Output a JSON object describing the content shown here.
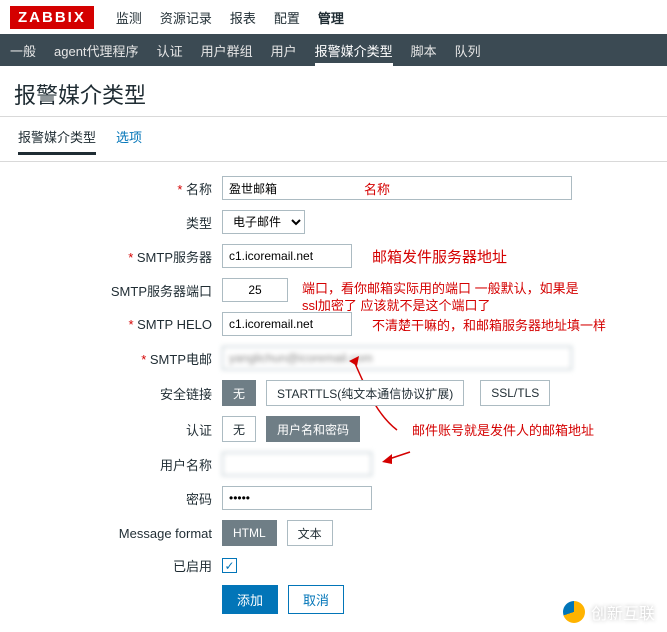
{
  "logo": "ZABBIX",
  "topmenu": [
    "监测",
    "资源记录",
    "报表",
    "配置",
    "管理"
  ],
  "topmenu_active": 4,
  "submenu": [
    "一般",
    "agent代理程序",
    "认证",
    "用户群组",
    "用户",
    "报警媒介类型",
    "脚本",
    "队列"
  ],
  "submenu_active": 5,
  "page_title": "报警媒介类型",
  "tabs": [
    "报警媒介类型",
    "选项"
  ],
  "tabs_active": 0,
  "labels": {
    "name": "名称",
    "type": "类型",
    "smtp_server": "SMTP服务器",
    "smtp_port": "SMTP服务器端口",
    "smtp_helo": "SMTP HELO",
    "smtp_email": "SMTP电邮",
    "security": "安全链接",
    "auth": "认证",
    "username": "用户名称",
    "password": "密码",
    "msgformat": "Message format",
    "enabled": "已启用"
  },
  "values": {
    "name": "盈世邮箱",
    "type": "电子邮件",
    "smtp_server": "c1.icoremail.net",
    "smtp_port": "25",
    "smtp_helo": "c1.icoremail.net",
    "smtp_email": "yanglichun@icoremail.com",
    "password": "•••••"
  },
  "segments": {
    "security": [
      "无",
      "STARTTLS(纯文本通信协议扩展)",
      "SSL/TLS"
    ],
    "security_sel": 0,
    "auth": [
      "无",
      "用户名和密码"
    ],
    "auth_sel": 1,
    "msgformat": [
      "HTML",
      "文本"
    ],
    "msgformat_sel": 0
  },
  "buttons": {
    "add": "添加",
    "cancel": "取消"
  },
  "annotations": {
    "name": "名称",
    "smtp_server": "邮箱发件服务器地址",
    "port_line1": "端口，看你邮箱实际用的端口 一般默认，如果是",
    "port_line2": "ssl加密了 应该就不是这个端口了",
    "helo": "不清楚干嘛的，和邮箱服务器地址填一样",
    "email": "邮件账号就是发件人的邮箱地址"
  },
  "watermark": "创新互联"
}
